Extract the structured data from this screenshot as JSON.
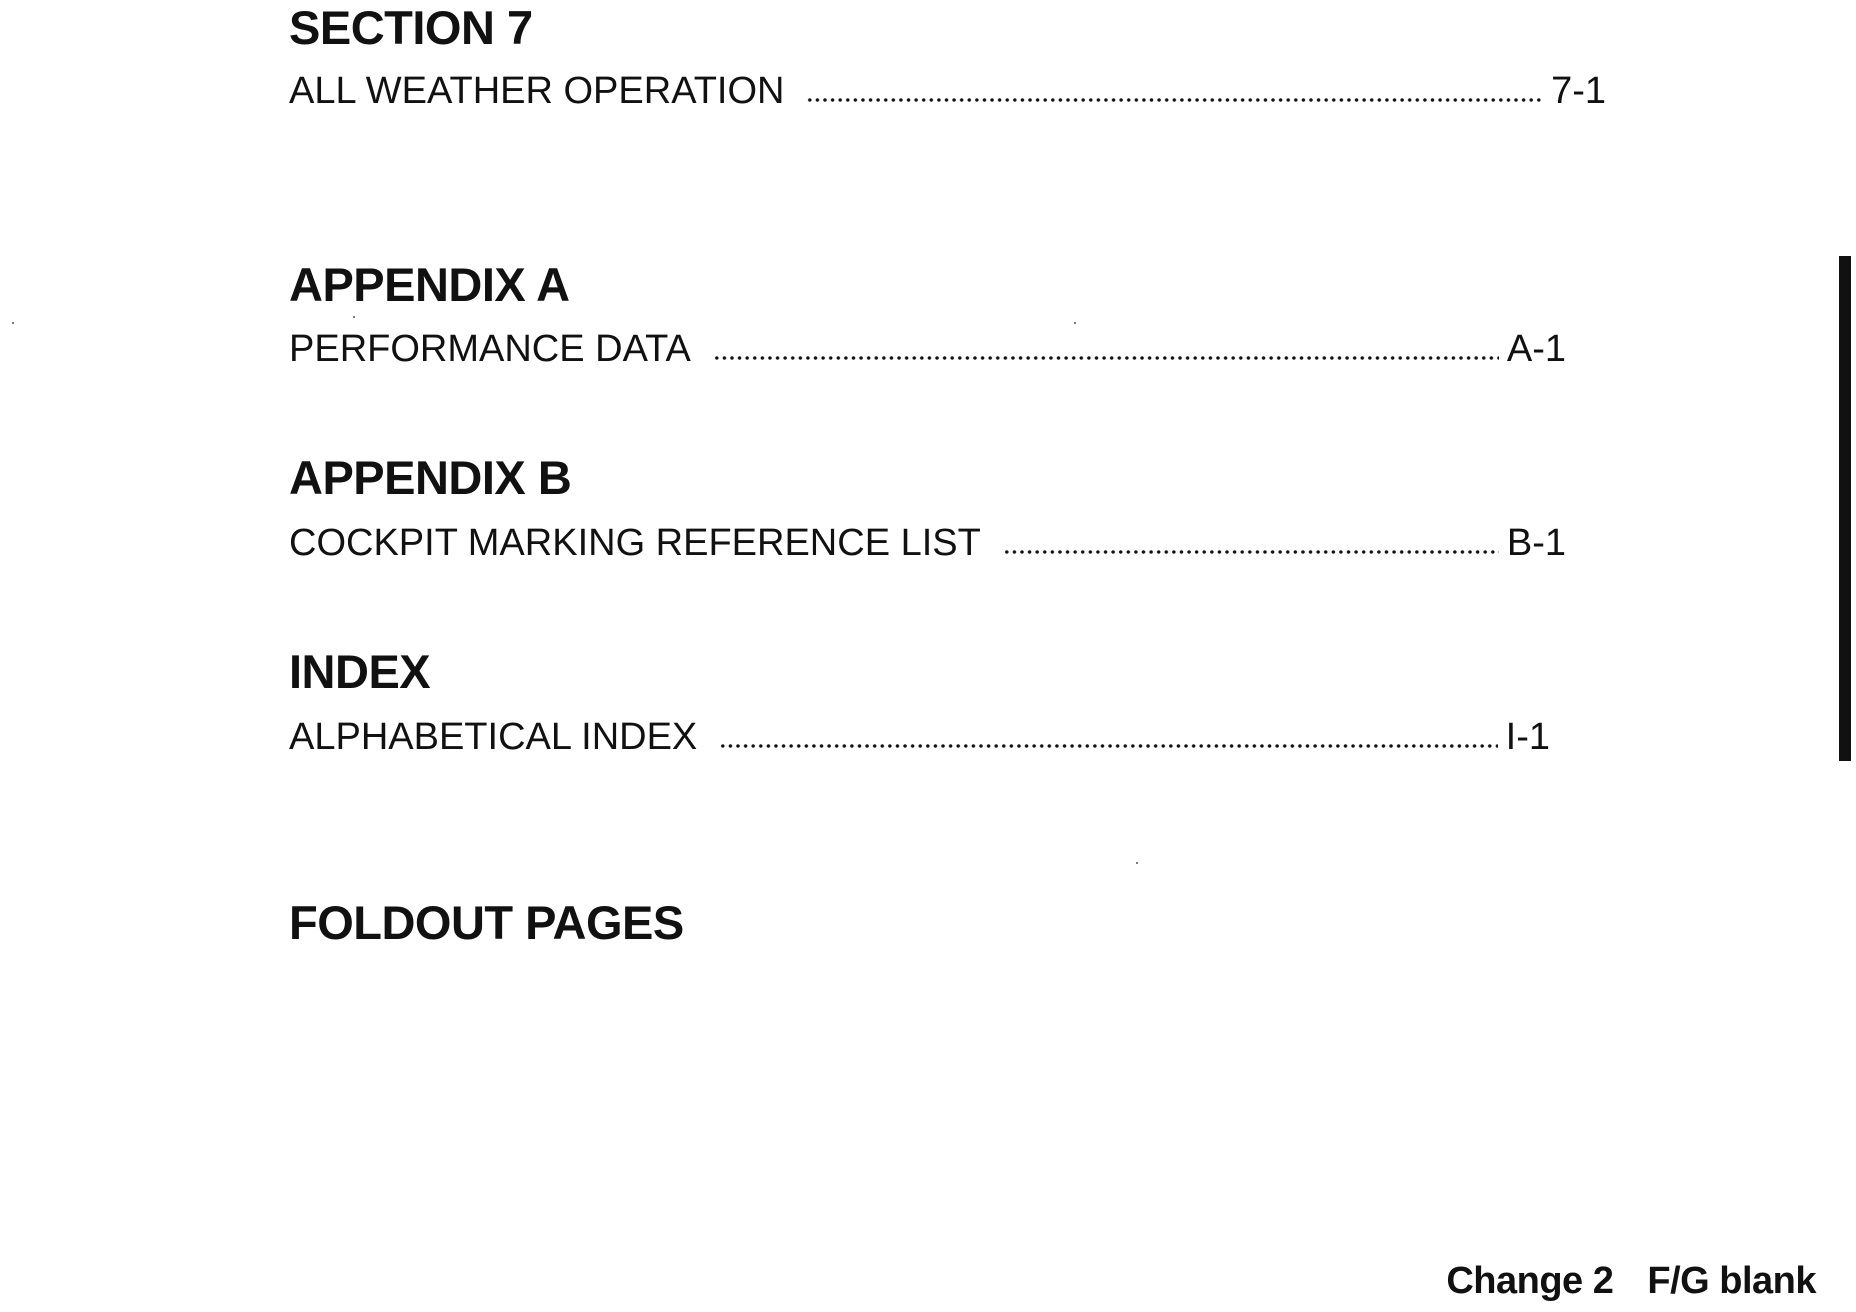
{
  "sections": [
    {
      "heading": "SECTION 7",
      "entries": [
        {
          "title": "ALL WEATHER OPERATION",
          "page": "7-1"
        }
      ]
    },
    {
      "heading": "APPENDIX A",
      "entries": [
        {
          "title": "PERFORMANCE DATA",
          "page": "A-1"
        }
      ]
    },
    {
      "heading": "APPENDIX B",
      "entries": [
        {
          "title": "COCKPIT MARKING REFERENCE LIST",
          "page": "B-1"
        }
      ]
    },
    {
      "heading": "INDEX",
      "entries": [
        {
          "title": "ALPHABETICAL INDEX",
          "page": "I-1"
        }
      ]
    },
    {
      "heading": "FOLDOUT PAGES",
      "entries": []
    }
  ],
  "footer": {
    "change": "Change 2",
    "page_label": "F/G blank"
  },
  "colors": {
    "ink": "#111111",
    "paper": "#ffffff"
  }
}
